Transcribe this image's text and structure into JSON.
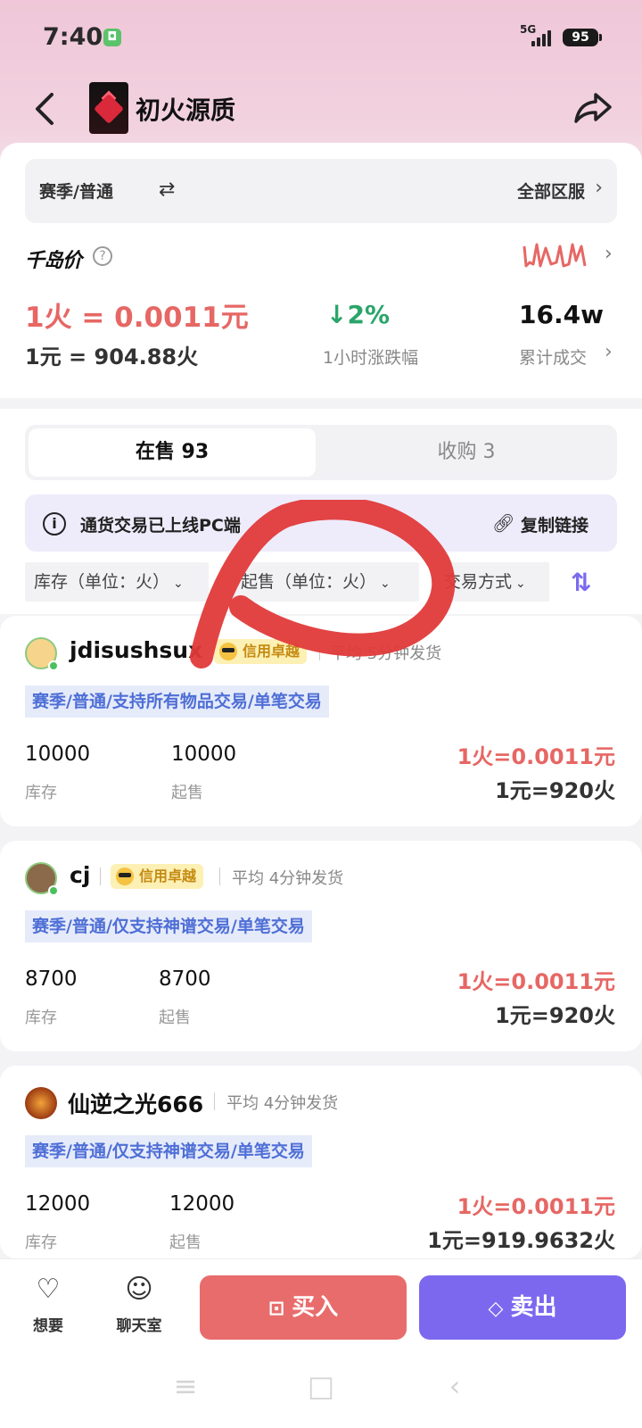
{
  "status_bar": {
    "time": "7:40",
    "network": "5G",
    "battery": "95"
  },
  "header": {
    "title": "初火源质"
  },
  "info": {
    "season": "赛季/普通",
    "region": "全部区服",
    "price_label": "千岛价",
    "price_main": "1火 = 0.0011元",
    "price_sub": "1元 = 904.88火",
    "change_value": "2%",
    "change_label": "1小时涨跌幅",
    "volume_value": "16.4w",
    "volume_label": "累计成交"
  },
  "tabs": {
    "on_sale": "在售 93",
    "buying": "收购 3"
  },
  "notice": {
    "text": "通货交易已上线PC端",
    "copy_label": "复制链接"
  },
  "filters": {
    "stock": "库存（单位：火）",
    "min_sale": "起售（单位：火）",
    "trade_method": "交易方式"
  },
  "listings": [
    {
      "name": "jdisushsux",
      "credit": "信用卓越",
      "delivery": "平均 5分钟发货",
      "tags": "赛季/普通/支持所有物品交易/单笔交易",
      "stock": "10000",
      "stock_label": "库存",
      "min_sale": "10000",
      "min_label": "起售",
      "price1": "1火=0.0011元",
      "price2": "1元=920火"
    },
    {
      "name": "cj",
      "credit": "信用卓越",
      "delivery": "平均 4分钟发货",
      "tags": "赛季/普通/仅支持神谱交易/单笔交易",
      "stock": "8700",
      "stock_label": "库存",
      "min_sale": "8700",
      "min_label": "起售",
      "price1": "1火=0.0011元",
      "price2": "1元=920火"
    },
    {
      "name": "仙逆之光666",
      "delivery": "平均 4分钟发货",
      "tags": "赛季/普通/仅支持神谱交易/单笔交易",
      "stock": "12000",
      "stock_label": "库存",
      "min_sale": "12000",
      "min_label": "起售",
      "price1": "1火=0.0011元",
      "price2": "1元=919.9632火"
    }
  ],
  "bottom": {
    "want": "想要",
    "chat": "聊天室",
    "buy": "买入",
    "sell": "卖出"
  },
  "colors": {
    "accent_red": "#e66764",
    "accent_purple": "#7c68ef",
    "up_green": "#2aa56a",
    "tag_blue": "#4f6fd6"
  }
}
